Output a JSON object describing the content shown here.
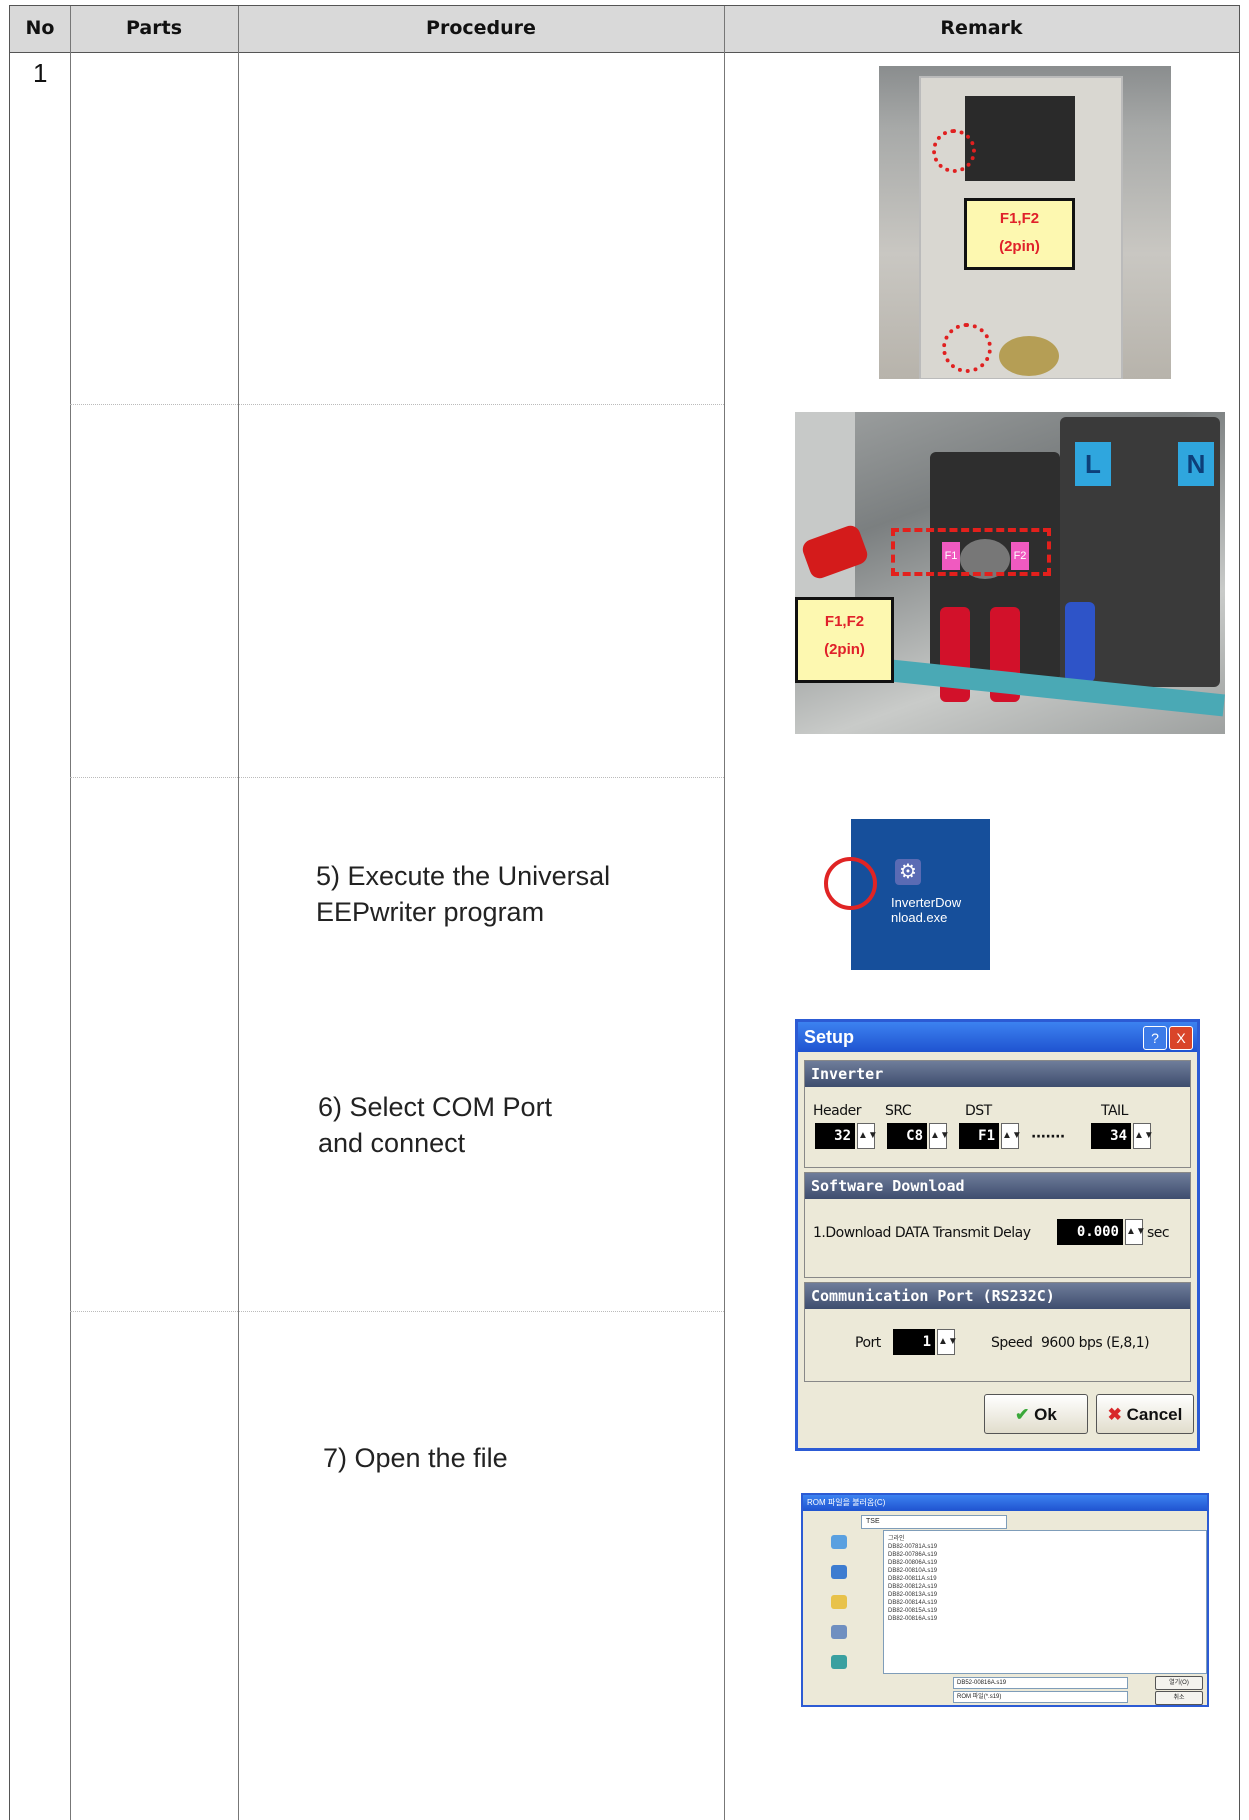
{
  "header": {
    "no": "No",
    "parts": "Parts",
    "procedure": "Procedure",
    "remark": "Remark"
  },
  "row": {
    "no": "1",
    "steps": [
      "5) Execute the Universal\nEEPwriter program",
      "6) Select COM Port\n and connect",
      "7) Open the file"
    ]
  },
  "photo1": {
    "tag_line1": "F1,F2",
    "tag_line2": "(2pin)"
  },
  "photo2": {
    "tag_line1": "F1,F2",
    "tag_line2": "(2pin)",
    "terminal_l": "L",
    "terminal_n": "N",
    "pin_f1": "F1",
    "pin_f2": "F2"
  },
  "icon": {
    "name": "InverterDow\nnload.exe"
  },
  "setup_dialog": {
    "title": "Setup",
    "help_button": "?",
    "close_button": "X",
    "inverter_group": "Inverter",
    "header_label": "Header",
    "src_label": "SRC",
    "dst_label": "DST",
    "tail_label": "TAIL",
    "header_value": "32",
    "src_value": "C8",
    "dst_value": "F1",
    "tail_value": "34",
    "dots": "·······",
    "software_group": "Software Download",
    "delay_label": "1.Download DATA Transmit Delay",
    "delay_value": "0.000",
    "delay_unit": "sec",
    "comm_group": "Communication Port (RS232C)",
    "port_label": "Port",
    "port_value": "1",
    "speed_label": "Speed",
    "speed_value": "9600 bps (E,8,1)",
    "ok_label": "Ok",
    "cancel_label": "Cancel"
  },
  "file_dialog": {
    "title": "ROM 파일을 불러옴(C)",
    "folder": "TSE",
    "files": [
      "그라인",
      "DB82-00781A.s19",
      "DB82-00786A.s19",
      "DB82-00806A.s19",
      "DB82-00810A.s19",
      "DB82-00811A.s19",
      "DB82-00812A.s19",
      "DB82-00813A.s19",
      "DB82-00814A.s19",
      "DB82-00815A.s19",
      "DB82-00816A.s19"
    ],
    "filename_value": "DB52-00816A.s19",
    "filetype_value": "ROM 파일(*.s19)",
    "open_label": "열기(O)",
    "cancel_label": "취소"
  }
}
